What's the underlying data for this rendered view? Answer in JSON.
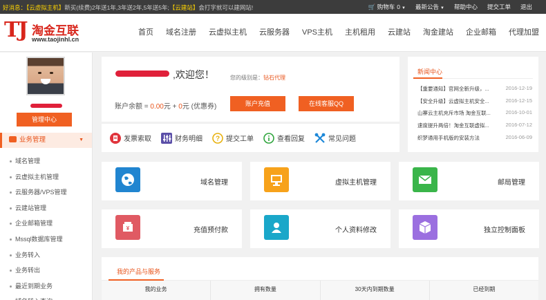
{
  "topbar": {
    "notice_label": "好消息：",
    "notice_highlight": "【云虚拟主机】",
    "notice_text": "新买(续费)2年送1年,3年送2年,5年送5年;",
    "notice_highlight2": "【云建站】",
    "notice_text2": "会打字就可以建网站!",
    "cart_label": "购物车",
    "cart_count": "0",
    "announce_label": "最新公告",
    "help_label": "帮助中心",
    "ticket_label": "提交工单",
    "logout_label": "退出"
  },
  "brand": {
    "logo_mark": "TJ",
    "name": "淘金互联",
    "url": "www.taojinhl.cn",
    "color": "#d8261c"
  },
  "nav": {
    "items": [
      "首页",
      "域名注册",
      "云虚拟主机",
      "云服务器",
      "VPS主机",
      "主机租用",
      "云建站",
      "淘金建站",
      "企业邮箱",
      "代理加盟"
    ]
  },
  "sidebar": {
    "manage_button": "管理中心",
    "menu_title": "业务管理",
    "items": [
      "域名管理",
      "云虚拟主机管理",
      "云服务器/VPS管理",
      "云建站管理",
      "企业邮箱管理",
      "Mssql数据库管理",
      "业务转入",
      "业务转出",
      "最近到期业务",
      "域名转入查询"
    ]
  },
  "welcome": {
    "greeting": ",欢迎您！",
    "level_label": "您的级别是：",
    "level_value": "钻石代理",
    "balance_label": "账户余额 = ",
    "balance_value": "0.00",
    "unit": "元",
    "plus": " + ",
    "coupon_value": "0",
    "coupon_label": "元 (优惠券)",
    "recharge_button": "账户充值",
    "service_button": "在线客服QQ"
  },
  "quick_links": {
    "invoice": "发票索取",
    "finance": "财务明细",
    "ticket": "提交工单",
    "reply": "查看回复",
    "faq": "常见问题"
  },
  "news": {
    "title": "新闻中心",
    "items": [
      {
        "title": "【重要通知】官网全新升级，...",
        "date": "2016-12-19"
      },
      {
        "title": "【安全升级】云虚拟主机安全...",
        "date": "2016-12-15"
      },
      {
        "title": "山寨云主机充斥市场 淘金互联...",
        "date": "2016-10-01"
      },
      {
        "title": "速度提升两倍！淘金互联虚拟...",
        "date": "2016-07-12"
      },
      {
        "title": "织梦通用手机版的安装方法",
        "date": "2016-06-09"
      }
    ]
  },
  "tiles": {
    "domain": "域名管理",
    "vhost": "虚拟主机管理",
    "mail": "邮局管理",
    "prepay": "充值预付款",
    "profile": "个人资料修改",
    "panel": "独立控制面板"
  },
  "products": {
    "title": "我的产品与服务",
    "columns": [
      "我的业务",
      "拥有数量",
      "30天内到期数量",
      "已经到期"
    ]
  },
  "colors": {
    "accent": "#f06022",
    "topbar": "#3c3c3c",
    "tile_blue": "#2185d0",
    "tile_orange": "#f7a21b",
    "tile_green": "#3ab54a",
    "tile_red": "#e05a63",
    "tile_teal": "#1aa7c9",
    "tile_purple": "#9b6fe0"
  }
}
